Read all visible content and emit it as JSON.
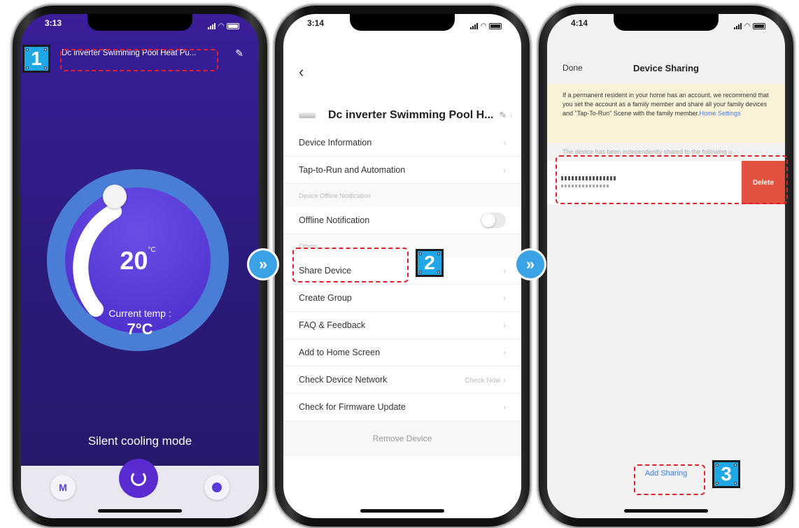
{
  "screen1": {
    "time": "3:13",
    "device_title": "Dc inverter Swimming Pool Heat Pu...",
    "setpoint": "20",
    "setpoint_unit": "°C",
    "current_temp_label": "Current temp :",
    "current_temp_value": "7°C",
    "mode": "Silent cooling mode",
    "mode_button": "M"
  },
  "screen2": {
    "time": "3:14",
    "device_name": "Dc inverter Swimming Pool H...",
    "items": {
      "device_information": "Device Information",
      "tap_to_run": "Tap-to-Run and Automation",
      "section_offline": "Device Offline Notification",
      "offline_notification": "Offline Notification",
      "section_others": "Others",
      "share_device": "Share Device",
      "create_group": "Create Group",
      "faq": "FAQ & Feedback",
      "add_home": "Add to Home Screen",
      "check_network": "Check Device Network",
      "check_now": "Check Now",
      "firmware": "Check for Firmware Update",
      "remove_device": "Remove Device"
    }
  },
  "screen3": {
    "time": "4:14",
    "done": "Done",
    "title": "Device Sharing",
    "notice_text": "If a permanent resident in your home has an account, we recommend that you set the account as a family member and share all your family devices and \"Tap-To-Run\" Scene with the family member.",
    "notice_link": "Home Settings",
    "shared_to": "The device has been independently shared to the following u",
    "delete": "Delete",
    "add_sharing": "Add Sharing"
  },
  "markers": {
    "m1": "1",
    "m2": "2",
    "m3": "3"
  },
  "arrows": {
    "a1": "»",
    "a2": "»"
  },
  "colors": {
    "accent_blue": "#1fa7e8",
    "annotation_red": "#e0202a",
    "app_purple": "#3a1e9a",
    "delete_red": "#e2513d"
  }
}
